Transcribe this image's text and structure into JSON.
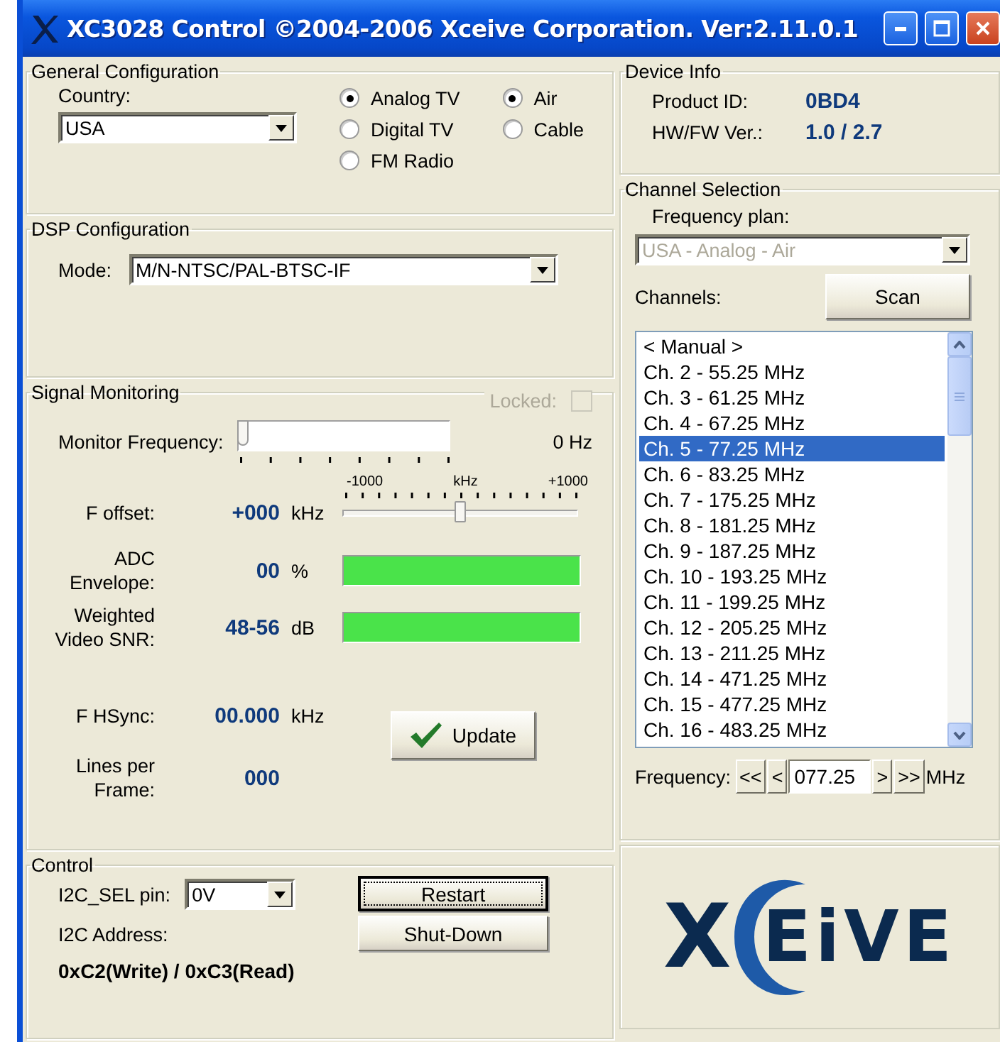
{
  "window": {
    "title": "XC3028 Control ©2004-2006 Xceive Corporation. Ver:2.11.0.1"
  },
  "general_configuration": {
    "title": "General Configuration",
    "country_label": "Country:",
    "country": "USA",
    "modes": [
      {
        "label": "Analog TV",
        "selected": true
      },
      {
        "label": "Digital TV",
        "selected": false
      },
      {
        "label": "FM Radio",
        "selected": false
      }
    ],
    "sources": [
      {
        "label": "Air",
        "selected": true
      },
      {
        "label": "Cable",
        "selected": false
      }
    ]
  },
  "dsp_configuration": {
    "title": "DSP Configuration",
    "mode_label": "Mode:",
    "mode": "M/N-NTSC/PAL-BTSC-IF"
  },
  "signal_monitoring": {
    "title": "Signal Monitoring",
    "locked": {
      "label": "Locked:",
      "checked": false,
      "disabled": true
    },
    "monitor_frequency": {
      "label": "Monitor Frequency:",
      "level": 0,
      "reading": "0 Hz"
    },
    "f_offset": {
      "label": "F offset:",
      "value": "+000",
      "unit": "kHz",
      "level": 0.5,
      "scale": [
        "-1000",
        "kHz",
        "+1000"
      ]
    },
    "meters": [
      {
        "label": "ADC Envelope:",
        "value": "00",
        "unit": "%",
        "level": 1
      },
      {
        "label": "Weighted Video SNR:",
        "value": "48-56",
        "unit": "dB",
        "level": 1
      }
    ],
    "f_hsync": {
      "label": "F HSync:",
      "value": "00.000",
      "unit": "kHz"
    },
    "lines_per_frame": {
      "label": "Lines per Frame:",
      "value": "000"
    },
    "update_button": "Update"
  },
  "control": {
    "title": "Control",
    "i2c_sel_label": "I2C_SEL pin:",
    "i2c_sel": "0V",
    "address_label": "I2C Address:",
    "address": "0xC2(Write) / 0xC3(Read)",
    "buttons": [
      {
        "label": "Restart",
        "focused": true
      },
      {
        "label": "Shut-Down",
        "focused": false
      }
    ]
  },
  "device_info": {
    "title": "Device Info",
    "rows": [
      {
        "label": "Product ID:",
        "value": "0BD4"
      },
      {
        "label": "HW/FW Ver.:",
        "value": "1.0 / 2.7"
      }
    ]
  },
  "channel_selection": {
    "title": "Channel Selection",
    "frequency_plan_label": "Frequency plan:",
    "frequency_plan": "USA - Analog - Air",
    "frequency_plan_disabled": true,
    "channels_label": "Channels:",
    "scan_button": "Scan",
    "channels": [
      {
        "label": "< Manual >",
        "selected": false
      },
      {
        "label": "Ch. 2 - 55.25 MHz",
        "selected": false
      },
      {
        "label": "Ch. 3 - 61.25 MHz",
        "selected": false
      },
      {
        "label": "Ch. 4 - 67.25 MHz",
        "selected": false
      },
      {
        "label": "Ch. 5 - 77.25 MHz",
        "selected": true
      },
      {
        "label": "Ch. 6 - 83.25 MHz",
        "selected": false
      },
      {
        "label": "Ch. 7 - 175.25 MHz",
        "selected": false
      },
      {
        "label": "Ch. 8 - 181.25 MHz",
        "selected": false
      },
      {
        "label": "Ch. 9 - 187.25 MHz",
        "selected": false
      },
      {
        "label": "Ch. 10 - 193.25 MHz",
        "selected": false
      },
      {
        "label": "Ch. 11 - 199.25 MHz",
        "selected": false
      },
      {
        "label": "Ch. 12 - 205.25 MHz",
        "selected": false
      },
      {
        "label": "Ch. 13 - 211.25 MHz",
        "selected": false
      },
      {
        "label": "Ch. 14 - 471.25 MHz",
        "selected": false
      },
      {
        "label": "Ch. 15 - 477.25 MHz",
        "selected": false
      },
      {
        "label": "Ch. 16 - 483.25 MHz",
        "selected": false
      }
    ],
    "frequency_label": "Frequency:",
    "step_down_buttons": [
      "<<",
      "<"
    ],
    "frequency": "077.25",
    "step_up_buttons": [
      ">",
      ">>"
    ],
    "frequency_unit": "MHz"
  },
  "logo": {
    "lead": "X",
    "tail": "EiVE"
  }
}
